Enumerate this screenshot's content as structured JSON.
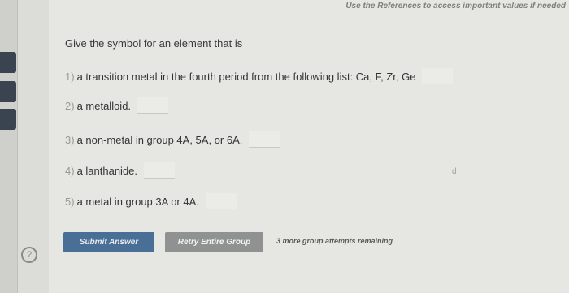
{
  "header": {
    "references_note": "Use the References to access important values if needed"
  },
  "prompt": "Give the symbol for an element that is",
  "questions": [
    {
      "num": "1)",
      "text": "a transition metal in the fourth period from the following list: Ca, F, Zr, Ge"
    },
    {
      "num": "2)",
      "text": "a metalloid."
    },
    {
      "num": "3)",
      "text": "a non-metal in group 4A, 5A, or 6A."
    },
    {
      "num": "4)",
      "text": "a lanthanide."
    },
    {
      "num": "5)",
      "text": "a metal in group 3A or 4A."
    }
  ],
  "marker": "d",
  "buttons": {
    "submit_label": "Submit Answer",
    "retry_label": "Retry Entire Group"
  },
  "attempts_text": "3 more group attempts remaining",
  "help_icon_glyph": "?"
}
